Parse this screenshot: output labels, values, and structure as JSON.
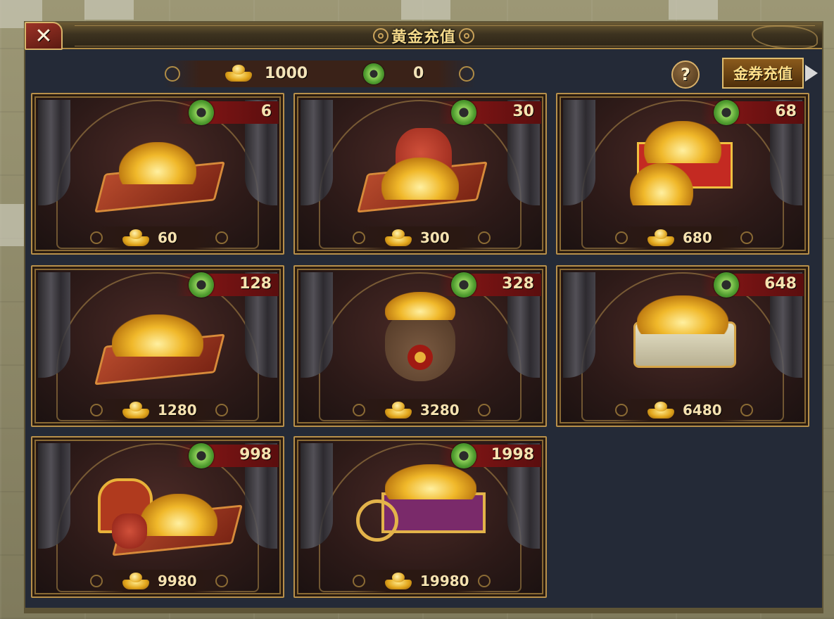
{
  "dialog": {
    "title": "黄金充值",
    "close_label": "✕"
  },
  "currency": {
    "gold_amount": "1000",
    "jade_amount": "0",
    "gold_icon": "gold-ingot-icon",
    "jade_icon": "jade-coin-icon"
  },
  "actions": {
    "help_label": "?",
    "voucher_label": "金券充值",
    "next_icon": "arrow-right-icon"
  },
  "packages": [
    {
      "price": "6",
      "gold": "60",
      "illustration": "ingots-on-cushion"
    },
    {
      "price": "30",
      "gold": "300",
      "illustration": "red-pouch-with-ingots"
    },
    {
      "price": "68",
      "gold": "680",
      "illustration": "red-gift-box-with-ingots"
    },
    {
      "price": "128",
      "gold": "1280",
      "illustration": "ingot-tray"
    },
    {
      "price": "328",
      "gold": "3280",
      "illustration": "sack-of-ingots"
    },
    {
      "price": "648",
      "gold": "6480",
      "illustration": "jade-box-of-ingots"
    },
    {
      "price": "998",
      "gold": "9980",
      "illustration": "treasure-chest-with-ingots"
    },
    {
      "price": "1998",
      "gold": "19980",
      "illustration": "cart-of-ingots"
    }
  ]
}
